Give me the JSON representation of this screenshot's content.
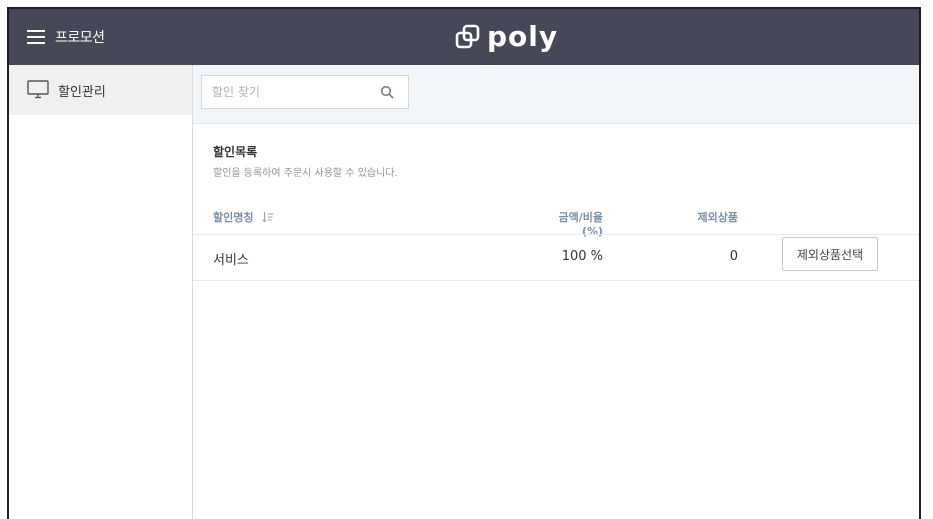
{
  "header": {
    "menu_label": "프로모션",
    "logo_text": "poly",
    "background_color": "#464858"
  },
  "sidebar": {
    "items": [
      {
        "label": "할인관리",
        "icon": "monitor-icon",
        "active": true
      }
    ]
  },
  "search": {
    "placeholder": "할인 찾기",
    "value": "",
    "icon": "search-icon"
  },
  "section": {
    "title": "할인목록",
    "description": "할인을 등록하여 주문시 사용할 수 있습니다."
  },
  "table": {
    "columns": [
      {
        "label": "할인명칭",
        "sortable": true
      },
      {
        "label": "금액/비율(%)"
      },
      {
        "label": "제외상품"
      }
    ],
    "rows": [
      {
        "name": "서비스",
        "amount": "100 %",
        "excluded": "0",
        "action_label": "제외상품선택"
      }
    ]
  }
}
